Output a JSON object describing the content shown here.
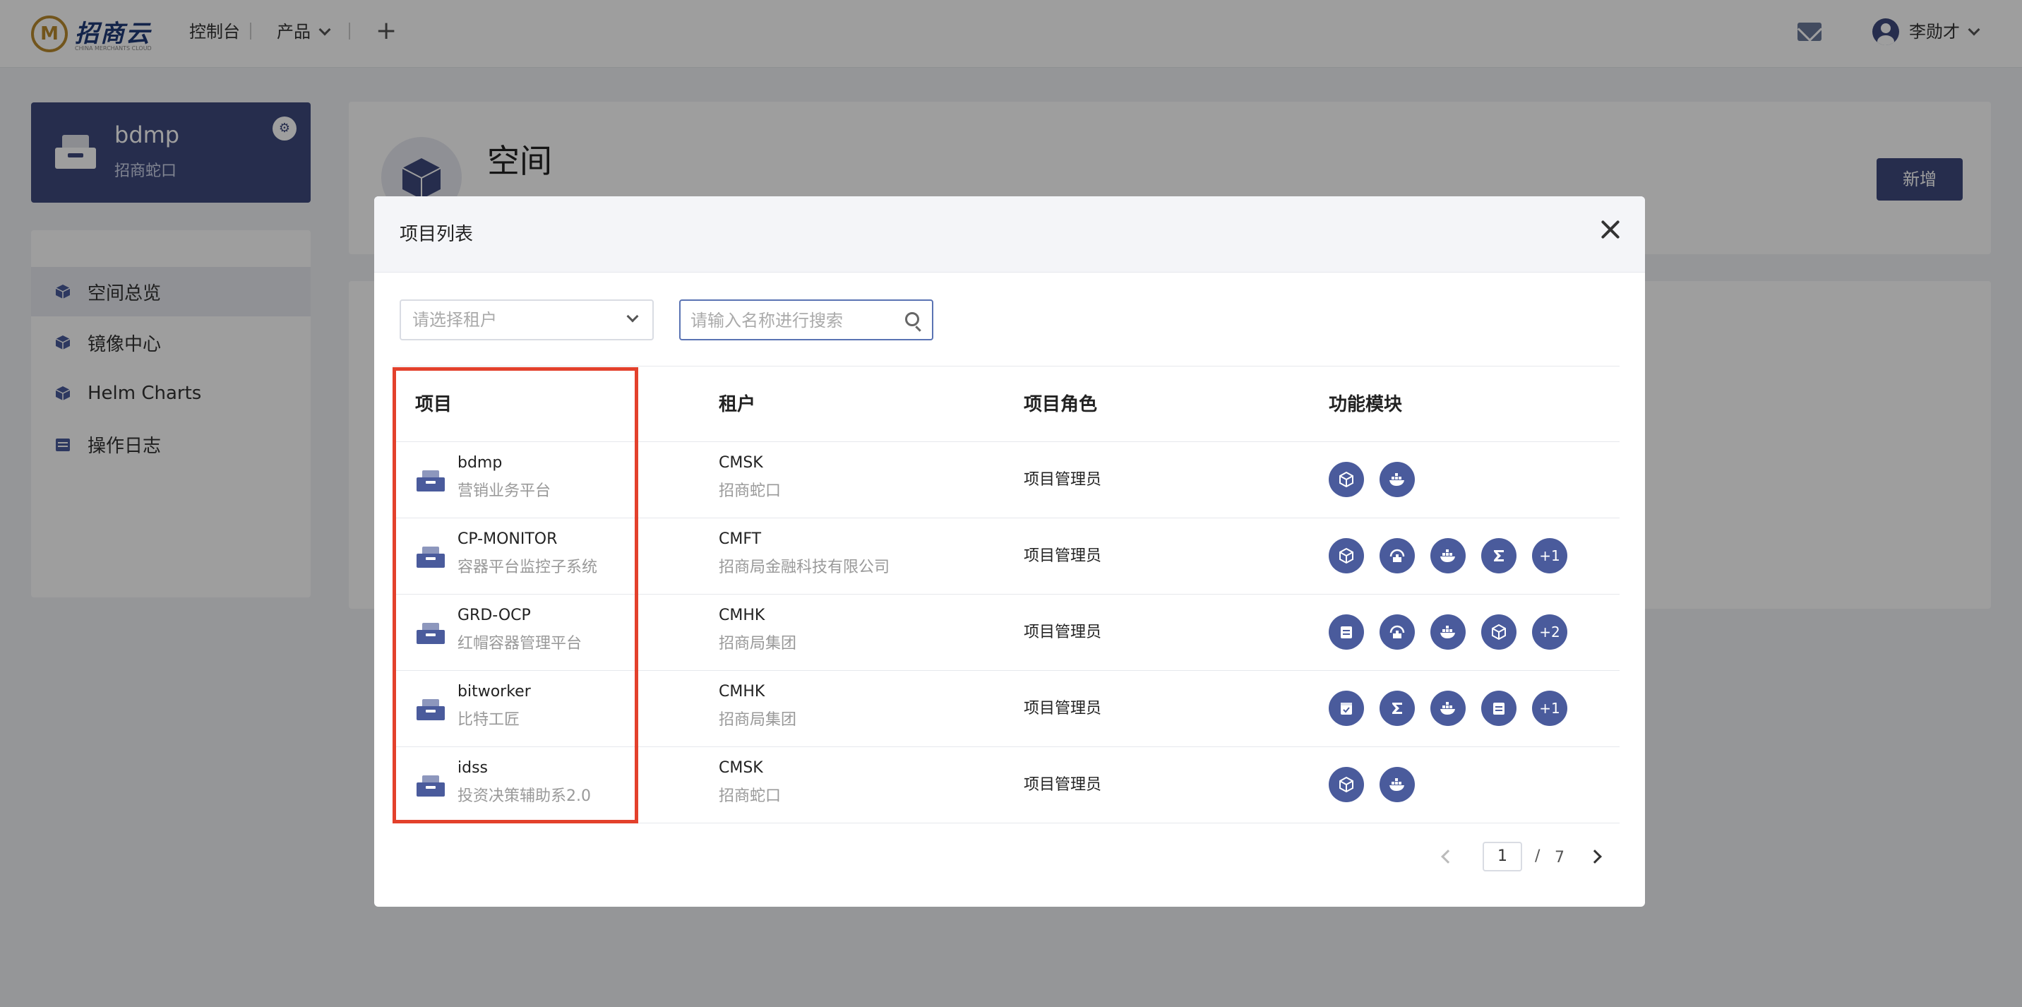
{
  "header": {
    "logo_text": "招商云",
    "logo_sub": "CHINA MERCHANTS CLOUD",
    "nav": [
      "控制台",
      "产品"
    ],
    "plus": "+",
    "user_name": "李勋才"
  },
  "space": {
    "title": "bdmp",
    "subtitle": "招商蛇口"
  },
  "sidebar": {
    "items": [
      {
        "label": "空间总览",
        "active": true
      },
      {
        "label": "镜像中心",
        "active": false
      },
      {
        "label": "Helm Charts",
        "active": false
      },
      {
        "label": "操作日志",
        "active": false
      }
    ]
  },
  "page": {
    "title": "空间",
    "add_label": "新增"
  },
  "modal": {
    "title": "项目列表",
    "tenant_placeholder": "请选择租户",
    "search_placeholder": "请输入名称进行搜索",
    "columns": [
      "项目",
      "租户",
      "项目角色",
      "功能模块"
    ],
    "rows": [
      {
        "name": "bdmp",
        "desc": "营销业务平台",
        "tenant": "CMSK",
        "tenant_name": "招商蛇口",
        "role": "项目管理员",
        "modules": [
          "cube-icon",
          "docker-icon"
        ],
        "extra": ""
      },
      {
        "name": "CP-MONITOR",
        "desc": "容器平台监控子系统",
        "tenant": "CMFT",
        "tenant_name": "招商局金融科技有限公司",
        "role": "项目管理员",
        "modules": [
          "cube-icon",
          "gateway-icon",
          "docker-icon",
          "sigma-icon"
        ],
        "extra": "+1"
      },
      {
        "name": "GRD-OCP",
        "desc": "红帽容器管理平台",
        "tenant": "CMHK",
        "tenant_name": "招商局集团",
        "role": "项目管理员",
        "modules": [
          "calendar-icon",
          "gateway-icon",
          "docker-icon",
          "cube-icon"
        ],
        "extra": "+2"
      },
      {
        "name": "bitworker",
        "desc": "比特工匠",
        "tenant": "CMHK",
        "tenant_name": "招商局集团",
        "role": "项目管理员",
        "modules": [
          "calendar-check-icon",
          "sigma-icon",
          "docker-icon",
          "calendar-icon"
        ],
        "extra": "+1"
      },
      {
        "name": "idss",
        "desc": "投资决策辅助系2.0",
        "tenant": "CMSK",
        "tenant_name": "招商蛇口",
        "role": "项目管理员",
        "modules": [
          "cube-icon",
          "docker-icon"
        ],
        "extra": ""
      }
    ],
    "pagination": {
      "current": "1",
      "separator": "/",
      "total": "7"
    }
  },
  "colors": {
    "primary": "#3e4a7c",
    "module": "#4a5b9c",
    "highlight": "#e3412c"
  }
}
